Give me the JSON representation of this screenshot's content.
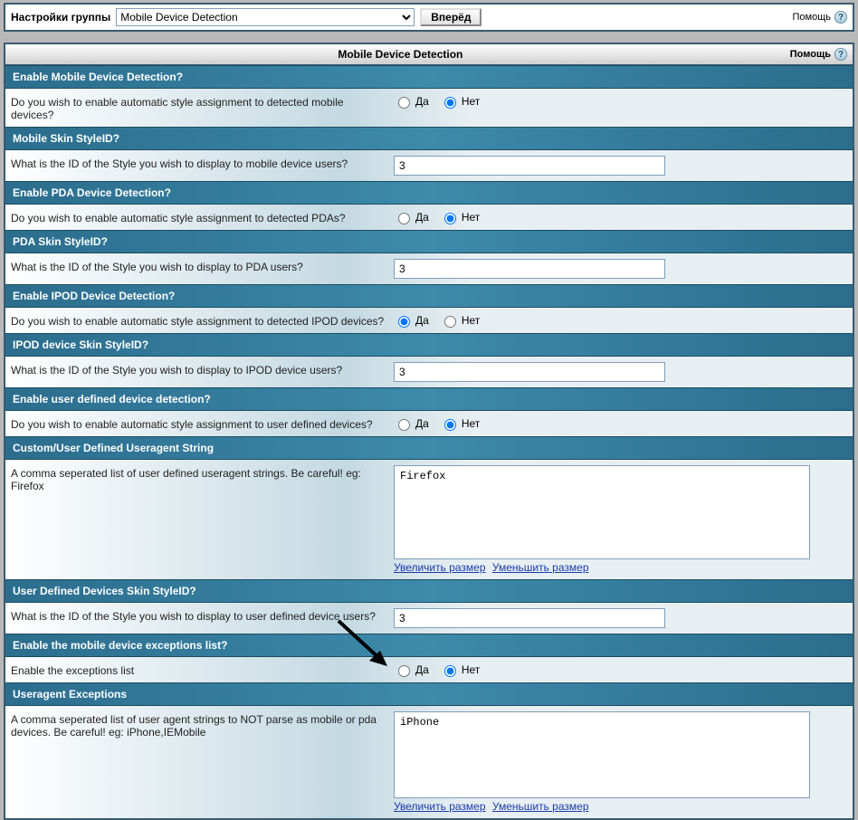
{
  "topbar": {
    "label": "Настройки группы",
    "selected": "Mobile Device Detection",
    "go": "Вперёд",
    "help": "Помощь"
  },
  "panel": {
    "title": "Mobile Device Detection",
    "help": "Помощь"
  },
  "yes": "Да",
  "no": "Нет",
  "enlarge": "Увеличить размер",
  "shrink": "Уменьшить размер",
  "sections": {
    "s1": {
      "head": "Enable Mobile Device Detection?",
      "desc": "Do you wish to enable automatic style assignment to detected mobile devices?",
      "sel": "no"
    },
    "s2": {
      "head": "Mobile Skin StyleID?",
      "desc": "What is the ID of the Style you wish to display to mobile device users?",
      "val": "3"
    },
    "s3": {
      "head": "Enable PDA Device Detection?",
      "desc": "Do you wish to enable automatic style assignment to detected PDAs?",
      "sel": "no"
    },
    "s4": {
      "head": "PDA Skin StyleID?",
      "desc": "What is the ID of the Style you wish to display to PDA users?",
      "val": "3"
    },
    "s5": {
      "head": "Enable IPOD Device Detection?",
      "desc": "Do you wish to enable automatic style assignment to detected IPOD devices?",
      "sel": "yes"
    },
    "s6": {
      "head": "IPOD device Skin StyleID?",
      "desc": "What is the ID of the Style you wish to display to IPOD device users?",
      "val": "3"
    },
    "s7": {
      "head": "Enable user defined device detection?",
      "desc": "Do you wish to enable automatic style assignment to user defined devices?",
      "sel": "no"
    },
    "s8": {
      "head": "Custom/User Defined Useragent String",
      "desc": "A comma seperated list of user defined useragent strings. Be careful! eg: Firefox",
      "val": "Firefox"
    },
    "s9": {
      "head": "User Defined Devices Skin StyleID?",
      "desc": "What is the ID of the Style you wish to display to user defined device users?",
      "val": "3"
    },
    "s10": {
      "head": "Enable the mobile device exceptions list?",
      "desc": "Enable the exceptions list",
      "sel": "no"
    },
    "s11": {
      "head": "Useragent Exceptions",
      "desc": "A comma seperated list of user agent strings to NOT parse as mobile or pda devices. Be careful! eg: iPhone,IEMobile",
      "val": "iPhone"
    }
  }
}
